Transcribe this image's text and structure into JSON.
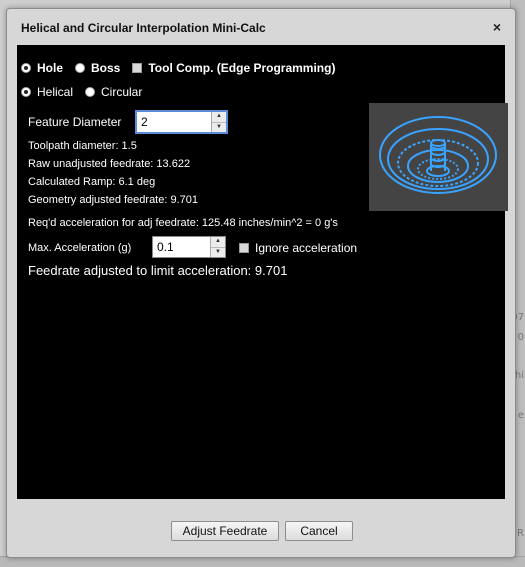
{
  "dialog": {
    "title": "Helical and Circular Interpolation Mini-Calc",
    "close_label": "×"
  },
  "feature_type": {
    "hole_label": "Hole",
    "boss_label": "Boss",
    "selected": "Hole",
    "tool_comp_label": "Tool Comp. (Edge Programming)",
    "tool_comp_checked": false
  },
  "interp_mode": {
    "helical_label": "Helical",
    "circular_label": "Circular",
    "selected": "Helical"
  },
  "feature_diameter": {
    "label": "Feature Diameter",
    "value": "2"
  },
  "results": {
    "toolpath_diameter": "Toolpath diameter: 1.5",
    "raw_feedrate": "Raw unadjusted feedrate: 13.622",
    "calculated_ramp": "Calculated Ramp: 6.1 deg",
    "geometry_feedrate": "Geometry adjusted feedrate: 9.701",
    "required_accel": "Req'd acceleration for adj feedrate: 125.48 inches/min^2 = 0 g's"
  },
  "max_accel": {
    "label": "Max. Acceleration (g)",
    "value": "0.1",
    "ignore_label": "Ignore acceleration",
    "ignore_checked": false
  },
  "final_feedrate": "Feedrate adjusted to limit acceleration: 9.701",
  "buttons": {
    "adjust_label": "Adjust Feedrate",
    "cancel_label": "Cancel"
  },
  "backdrop": {
    "fragments": [
      "07",
      "0",
      "hi",
      "e",
      "R"
    ]
  },
  "colors": {
    "content_bg": "#000000",
    "dialog_bg": "#d7d7d7",
    "thumb_bg": "#444444",
    "helix": "#3aa3ff",
    "focus": "#5b8ed6"
  },
  "icons": {
    "preview": "helix-preview-icon"
  }
}
